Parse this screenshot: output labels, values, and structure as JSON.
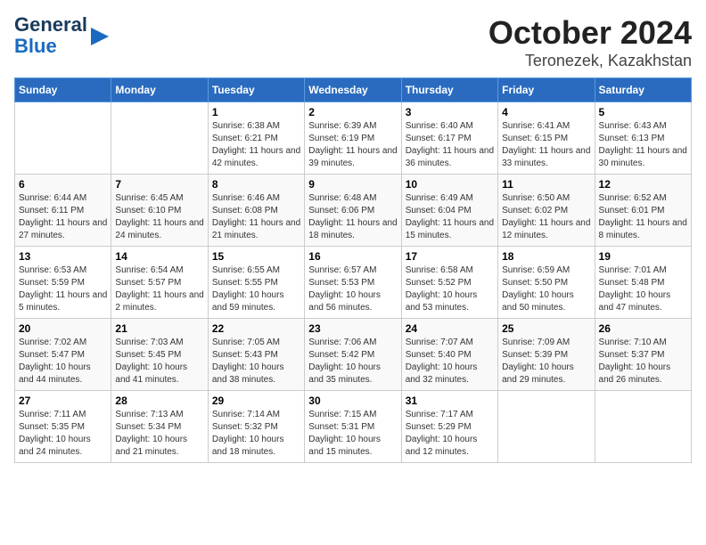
{
  "logo": {
    "line1": "General",
    "line2": "Blue"
  },
  "title": "October 2024",
  "subtitle": "Teronezek, Kazakhstan",
  "days_of_week": [
    "Sunday",
    "Monday",
    "Tuesday",
    "Wednesday",
    "Thursday",
    "Friday",
    "Saturday"
  ],
  "weeks": [
    [
      {
        "day": "",
        "info": ""
      },
      {
        "day": "",
        "info": ""
      },
      {
        "day": "1",
        "info": "Sunrise: 6:38 AM\nSunset: 6:21 PM\nDaylight: 11 hours and 42 minutes."
      },
      {
        "day": "2",
        "info": "Sunrise: 6:39 AM\nSunset: 6:19 PM\nDaylight: 11 hours and 39 minutes."
      },
      {
        "day": "3",
        "info": "Sunrise: 6:40 AM\nSunset: 6:17 PM\nDaylight: 11 hours and 36 minutes."
      },
      {
        "day": "4",
        "info": "Sunrise: 6:41 AM\nSunset: 6:15 PM\nDaylight: 11 hours and 33 minutes."
      },
      {
        "day": "5",
        "info": "Sunrise: 6:43 AM\nSunset: 6:13 PM\nDaylight: 11 hours and 30 minutes."
      }
    ],
    [
      {
        "day": "6",
        "info": "Sunrise: 6:44 AM\nSunset: 6:11 PM\nDaylight: 11 hours and 27 minutes."
      },
      {
        "day": "7",
        "info": "Sunrise: 6:45 AM\nSunset: 6:10 PM\nDaylight: 11 hours and 24 minutes."
      },
      {
        "day": "8",
        "info": "Sunrise: 6:46 AM\nSunset: 6:08 PM\nDaylight: 11 hours and 21 minutes."
      },
      {
        "day": "9",
        "info": "Sunrise: 6:48 AM\nSunset: 6:06 PM\nDaylight: 11 hours and 18 minutes."
      },
      {
        "day": "10",
        "info": "Sunrise: 6:49 AM\nSunset: 6:04 PM\nDaylight: 11 hours and 15 minutes."
      },
      {
        "day": "11",
        "info": "Sunrise: 6:50 AM\nSunset: 6:02 PM\nDaylight: 11 hours and 12 minutes."
      },
      {
        "day": "12",
        "info": "Sunrise: 6:52 AM\nSunset: 6:01 PM\nDaylight: 11 hours and 8 minutes."
      }
    ],
    [
      {
        "day": "13",
        "info": "Sunrise: 6:53 AM\nSunset: 5:59 PM\nDaylight: 11 hours and 5 minutes."
      },
      {
        "day": "14",
        "info": "Sunrise: 6:54 AM\nSunset: 5:57 PM\nDaylight: 11 hours and 2 minutes."
      },
      {
        "day": "15",
        "info": "Sunrise: 6:55 AM\nSunset: 5:55 PM\nDaylight: 10 hours and 59 minutes."
      },
      {
        "day": "16",
        "info": "Sunrise: 6:57 AM\nSunset: 5:53 PM\nDaylight: 10 hours and 56 minutes."
      },
      {
        "day": "17",
        "info": "Sunrise: 6:58 AM\nSunset: 5:52 PM\nDaylight: 10 hours and 53 minutes."
      },
      {
        "day": "18",
        "info": "Sunrise: 6:59 AM\nSunset: 5:50 PM\nDaylight: 10 hours and 50 minutes."
      },
      {
        "day": "19",
        "info": "Sunrise: 7:01 AM\nSunset: 5:48 PM\nDaylight: 10 hours and 47 minutes."
      }
    ],
    [
      {
        "day": "20",
        "info": "Sunrise: 7:02 AM\nSunset: 5:47 PM\nDaylight: 10 hours and 44 minutes."
      },
      {
        "day": "21",
        "info": "Sunrise: 7:03 AM\nSunset: 5:45 PM\nDaylight: 10 hours and 41 minutes."
      },
      {
        "day": "22",
        "info": "Sunrise: 7:05 AM\nSunset: 5:43 PM\nDaylight: 10 hours and 38 minutes."
      },
      {
        "day": "23",
        "info": "Sunrise: 7:06 AM\nSunset: 5:42 PM\nDaylight: 10 hours and 35 minutes."
      },
      {
        "day": "24",
        "info": "Sunrise: 7:07 AM\nSunset: 5:40 PM\nDaylight: 10 hours and 32 minutes."
      },
      {
        "day": "25",
        "info": "Sunrise: 7:09 AM\nSunset: 5:39 PM\nDaylight: 10 hours and 29 minutes."
      },
      {
        "day": "26",
        "info": "Sunrise: 7:10 AM\nSunset: 5:37 PM\nDaylight: 10 hours and 26 minutes."
      }
    ],
    [
      {
        "day": "27",
        "info": "Sunrise: 7:11 AM\nSunset: 5:35 PM\nDaylight: 10 hours and 24 minutes."
      },
      {
        "day": "28",
        "info": "Sunrise: 7:13 AM\nSunset: 5:34 PM\nDaylight: 10 hours and 21 minutes."
      },
      {
        "day": "29",
        "info": "Sunrise: 7:14 AM\nSunset: 5:32 PM\nDaylight: 10 hours and 18 minutes."
      },
      {
        "day": "30",
        "info": "Sunrise: 7:15 AM\nSunset: 5:31 PM\nDaylight: 10 hours and 15 minutes."
      },
      {
        "day": "31",
        "info": "Sunrise: 7:17 AM\nSunset: 5:29 PM\nDaylight: 10 hours and 12 minutes."
      },
      {
        "day": "",
        "info": ""
      },
      {
        "day": "",
        "info": ""
      }
    ]
  ]
}
